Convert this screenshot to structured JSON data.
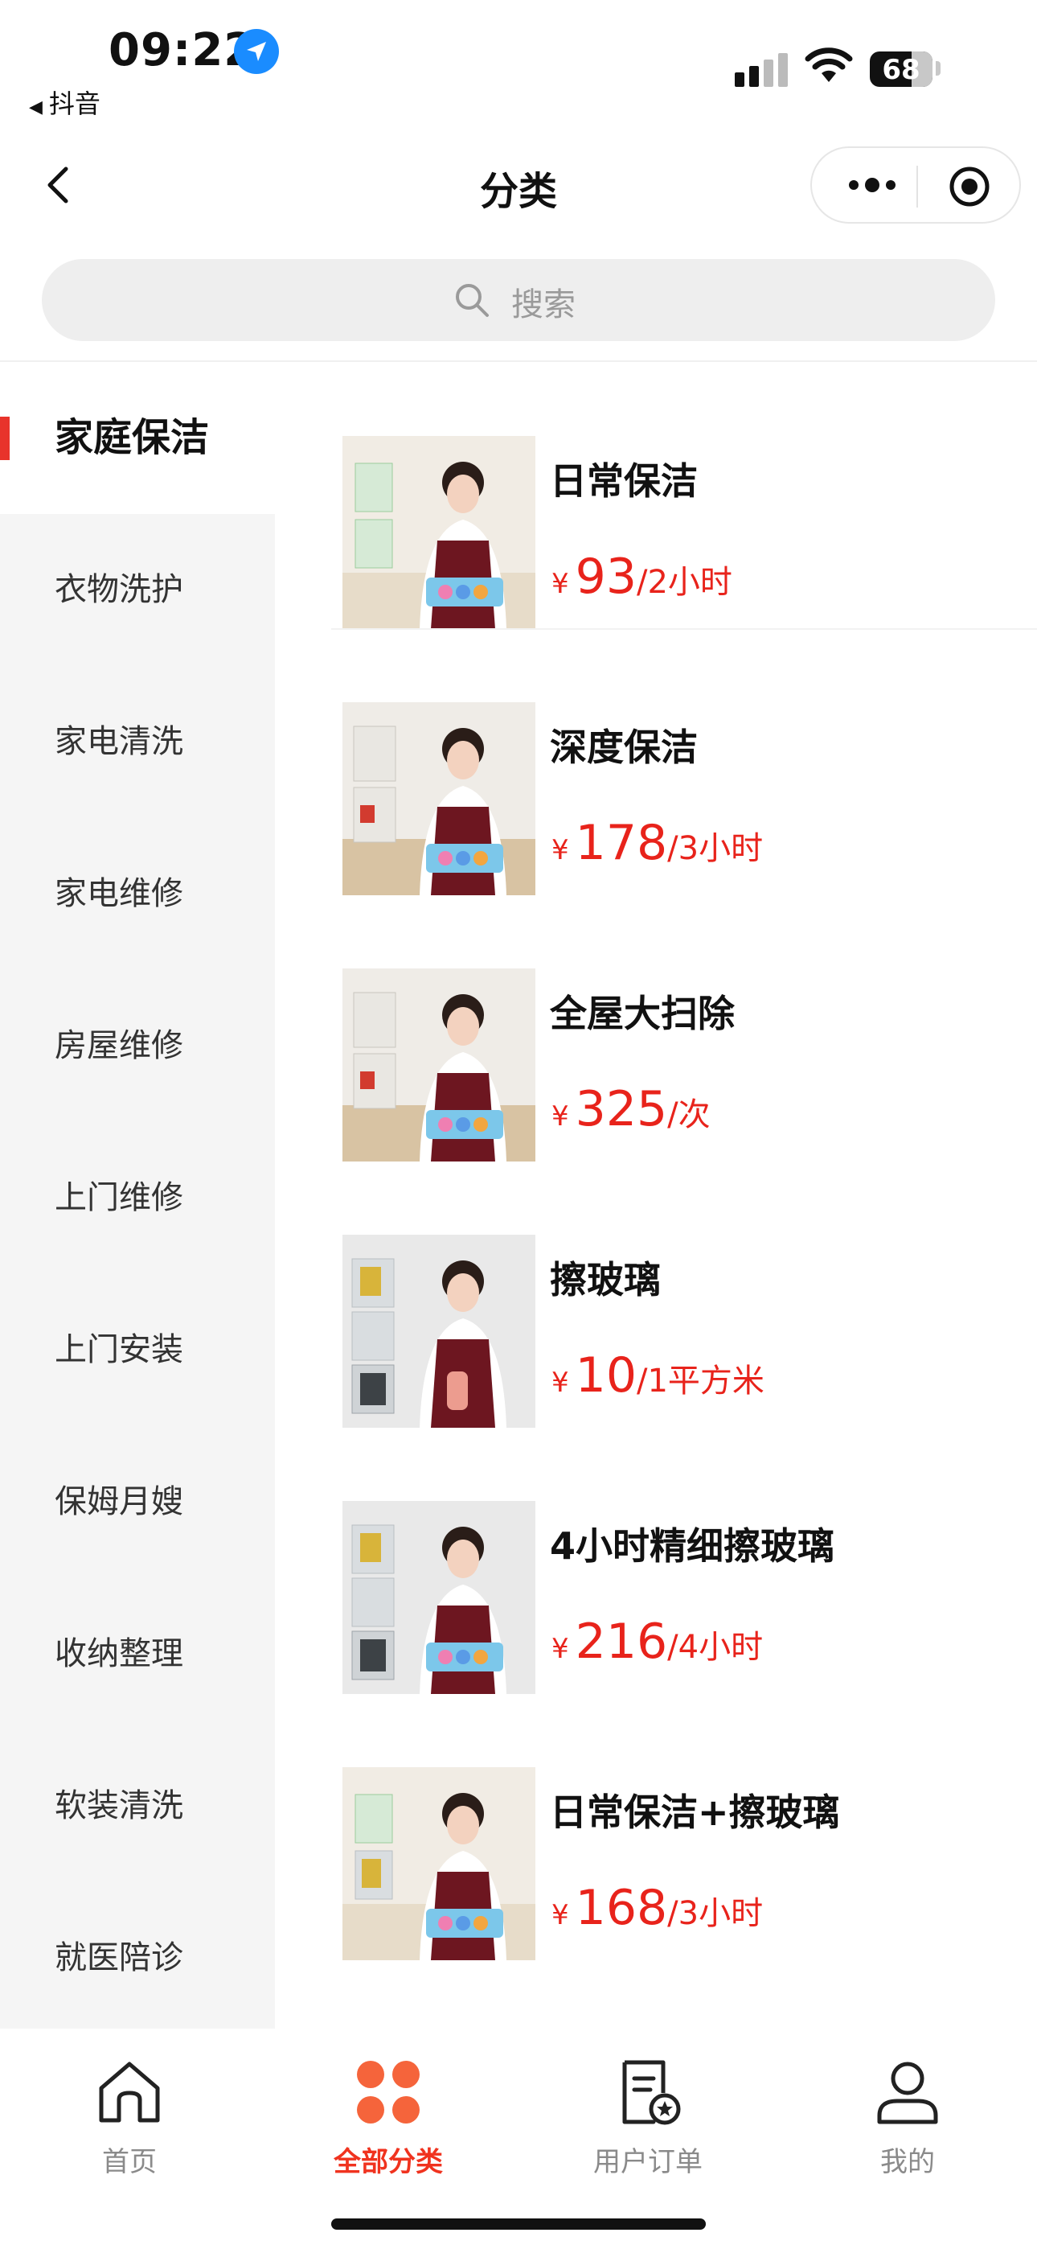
{
  "status_bar": {
    "time": "09:22",
    "back_app_label": "抖音",
    "battery_level": "68"
  },
  "nav": {
    "title": "分类"
  },
  "search": {
    "placeholder": "搜索"
  },
  "sidebar": {
    "items": [
      {
        "label": "家庭保洁",
        "active": true
      },
      {
        "label": "衣物洗护"
      },
      {
        "label": "家电清洗"
      },
      {
        "label": "家电维修"
      },
      {
        "label": "房屋维修"
      },
      {
        "label": "上门维修"
      },
      {
        "label": "上门安装"
      },
      {
        "label": "保姆月嫂"
      },
      {
        "label": "收纳整理"
      },
      {
        "label": "软装清洗"
      },
      {
        "label": "就医陪诊"
      }
    ]
  },
  "products": [
    {
      "name": "日常保洁",
      "currency": "¥",
      "price": "93",
      "unit": "/2小时"
    },
    {
      "name": "深度保洁",
      "currency": "¥",
      "price": "178",
      "unit": "/3小时"
    },
    {
      "name": "全屋大扫除",
      "currency": "¥",
      "price": "325",
      "unit": "/次"
    },
    {
      "name": "擦玻璃",
      "currency": "¥",
      "price": "10",
      "unit": "/1平方米"
    },
    {
      "name": "4小时精细擦玻璃",
      "currency": "¥",
      "price": "216",
      "unit": "/4小时"
    },
    {
      "name": "日常保洁+擦玻璃",
      "currency": "¥",
      "price": "168",
      "unit": "/3小时"
    }
  ],
  "tabbar": {
    "tabs": [
      {
        "label": "首页",
        "icon": "home-icon"
      },
      {
        "label": "全部分类",
        "icon": "category-icon",
        "active": true
      },
      {
        "label": "用户订单",
        "icon": "order-icon"
      },
      {
        "label": "我的",
        "icon": "profile-icon"
      }
    ]
  },
  "colors": {
    "accent": "#e8231b",
    "tab_active": "#f0331f",
    "category_icon": "#f5643b"
  }
}
